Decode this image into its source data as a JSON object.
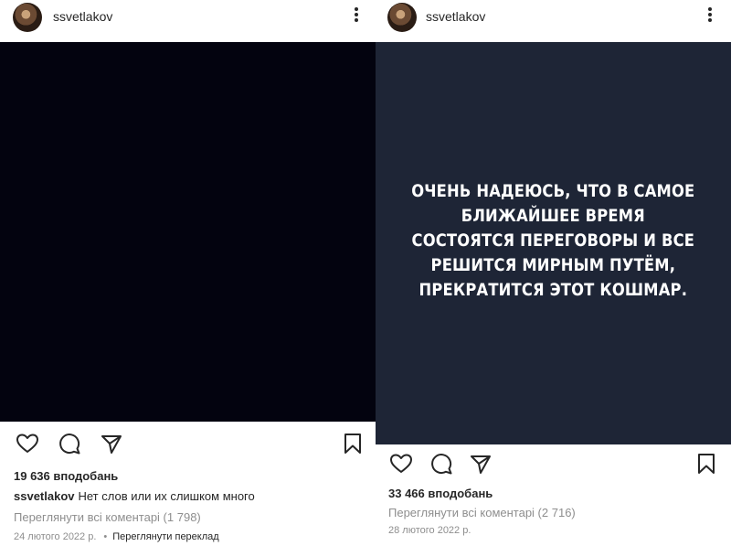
{
  "left_post": {
    "username": "ssvetlakov",
    "likes": "19 636 вподобань",
    "caption_user": "ssvetlakov",
    "caption_text": "Нет слов или их слишком много",
    "view_comments": "Переглянути всі коментарі (1 798)",
    "date": "24 лютого 2022 р.",
    "translate": "Переглянути переклад",
    "media_color": "#03030f"
  },
  "right_post": {
    "username": "ssvetlakov",
    "story_text": "ОЧЕНЬ НАДЕЮСЬ, ЧТО В САМОЕ\nБЛИЖАЙШЕЕ ВРЕМЯ\nСОСТОЯТСЯ ПЕРЕГОВОРЫ И ВСЕ\nРЕШИТСЯ МИРНЫМ ПУТЁМ,\nПРЕКРАТИТСЯ ЭТОТ КОШМАР.",
    "likes": "33 466 вподобань",
    "view_comments": "Переглянути всі коментарі (2 716)",
    "date": "28 лютого 2022 р.",
    "media_color": "#1e2536"
  },
  "icons": [
    "more-options-icon",
    "heart-icon",
    "comment-icon",
    "share-icon",
    "bookmark-icon"
  ]
}
